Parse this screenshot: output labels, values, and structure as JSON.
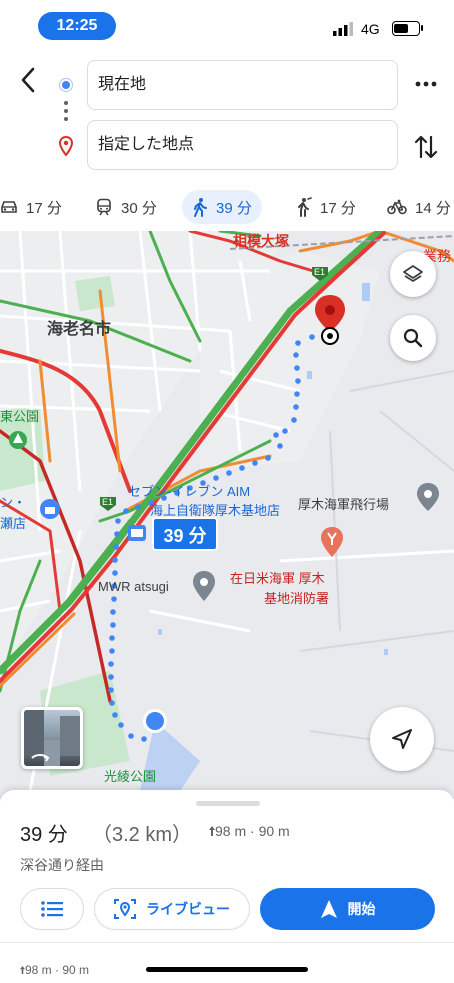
{
  "status_bar": {
    "time": "12:25",
    "network": "4G"
  },
  "search": {
    "origin": "現在地",
    "destination": "指定した地点"
  },
  "modes": [
    {
      "name": "car",
      "icon": "car-icon",
      "duration": "17 分"
    },
    {
      "name": "transit",
      "icon": "train-icon",
      "duration": "30 分"
    },
    {
      "name": "walk",
      "icon": "walking-icon",
      "duration": "39 分",
      "selected": true
    },
    {
      "name": "ride",
      "icon": "ride-hail-icon",
      "duration": "17 分"
    },
    {
      "name": "bike",
      "icon": "bicycle-icon",
      "duration": "14 分"
    }
  ],
  "map": {
    "labels": {
      "sagami_otsuka": "相模大塚",
      "ebina": "海老名市",
      "park_left": "東公園",
      "seven": "セブン-イレブン AIM",
      "jsdf": "海上自衛隊厚木基地店",
      "shop_left": "ン・",
      "shop_left2": "瀬店",
      "naf": "厚木海軍飛行場",
      "mwr": "MWR atsugi",
      "fire1": "在日米海軍 厚木",
      "fire2": "基地消防署",
      "koryo": "光綾公園",
      "gyomu": "業務",
      "e1_top": "E1",
      "e1_mid": "E1"
    },
    "route_time": "39 分"
  },
  "sheet": {
    "duration": "39 分",
    "distance": "（3.2 km）",
    "elevation": "98 m · 90 m",
    "via": "深谷通り経由",
    "live_view_label": "ライブビュー",
    "start_label": "開始",
    "elevation_small": "98 m · 90 m"
  },
  "colors": {
    "accent": "#1a73e8",
    "route": "#4285f4",
    "traffic_red": "#e53935",
    "traffic_orange": "#f28b31",
    "traffic_green": "#4caf50",
    "dest_pin": "#d93025",
    "map_bg": "#e8eaed"
  }
}
